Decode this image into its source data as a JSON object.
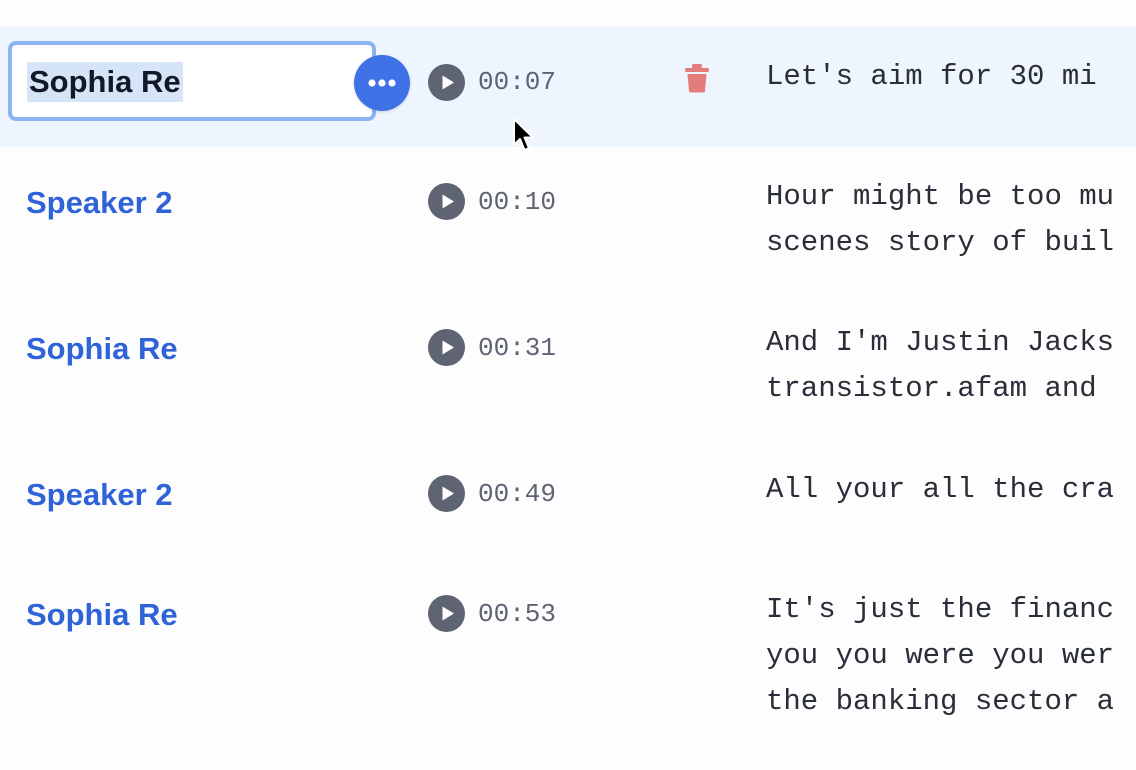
{
  "editing": {
    "speaker_value": "Sophia Re",
    "more_icon": "ellipsis-icon",
    "play_icon": "play-icon",
    "timestamp": "00:07",
    "delete_icon": "trash-icon",
    "text_lines": [
      "Let's aim for 30 mi"
    ]
  },
  "segments": [
    {
      "speaker": "Speaker 2",
      "timestamp": "00:10",
      "text_lines": [
        "Hour might be too mu",
        "scenes story of buil"
      ]
    },
    {
      "speaker": "Sophia Re",
      "timestamp": "00:31",
      "text_lines": [
        "And I'm Justin Jacks",
        "transistor.afam and"
      ]
    },
    {
      "speaker": "Speaker 2",
      "timestamp": "00:49",
      "text_lines": [
        "All your all the cra"
      ]
    },
    {
      "speaker": "Sophia Re",
      "timestamp": "00:53",
      "text_lines": [
        "It's just the financ",
        "you you were you wer",
        "the banking sector a"
      ]
    }
  ],
  "colors": {
    "accent": "#3e72e6",
    "speaker": "#2f63d8",
    "active_row": "#eef5fe",
    "delete": "#e57c7c",
    "play": "#5e6472"
  }
}
